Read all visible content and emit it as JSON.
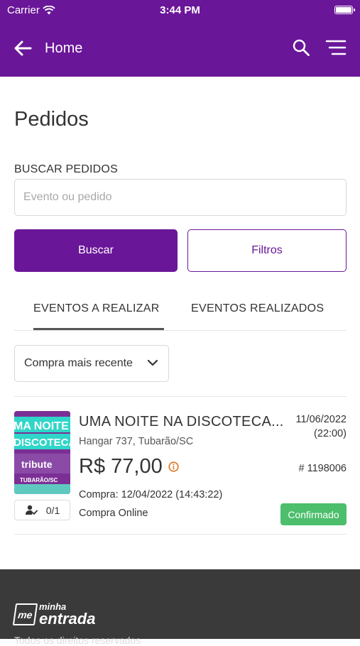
{
  "status_bar": {
    "carrier": "Carrier",
    "time": "3:44 PM"
  },
  "nav": {
    "title": "Home",
    "back_icon": "arrow-left-icon",
    "search_icon": "search-icon",
    "menu_icon": "hamburger-menu-icon"
  },
  "page": {
    "title": "Pedidos",
    "search_label": "BUSCAR PEDIDOS",
    "search_placeholder": "Evento ou pedido",
    "search_value": "",
    "buscar_label": "Buscar",
    "filtros_label": "Filtros"
  },
  "tabs": [
    {
      "label": "EVENTOS A REALIZAR",
      "active": true
    },
    {
      "label": "EVENTOS REALIZADOS",
      "active": false
    }
  ],
  "sort": {
    "selected": "Compra mais recente"
  },
  "orders": [
    {
      "event_name": "UMA NOITE NA DISCOTECA...",
      "venue": "Hangar 737, Tubarão/SC",
      "price": "R$ 77,00",
      "date": "11/06/2022",
      "time": "(22:00)",
      "order_number": "# 1198006",
      "purchase_date": "Compra: 12/04/2022 (14:43:22)",
      "purchase_type": "Compra Online",
      "status": "Confirmado",
      "tickets": "0/1",
      "poster": {
        "line1": "MA NOITE N",
        "line2": "DISCOTECA",
        "line3": "tribute",
        "line4": "TUBARÃO/SC"
      }
    }
  ],
  "footer": {
    "logo_small": "me",
    "logo_line1": "minha",
    "logo_line2": "entrada",
    "copyright": "Todos os direitos reservados"
  },
  "colors": {
    "primary": "#6a1699",
    "success": "#4cbe6c",
    "footer_bg": "#3a3a3a"
  }
}
